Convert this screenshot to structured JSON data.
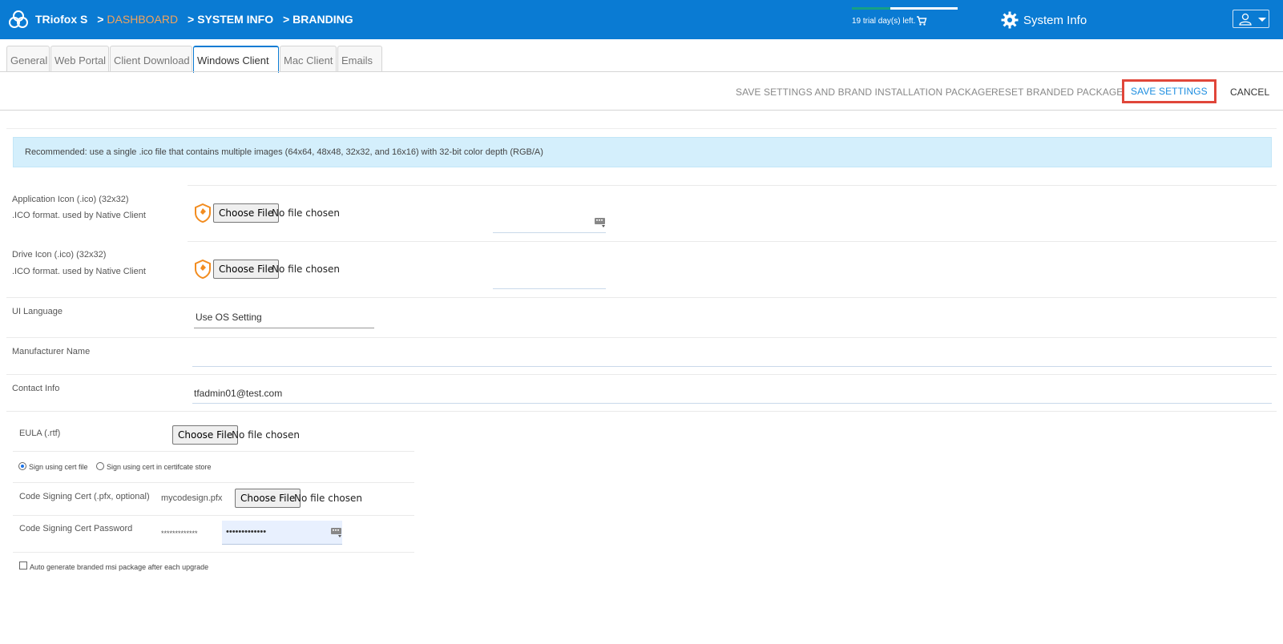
{
  "header": {
    "app_name": "TRiofox S",
    "crumbs": [
      "DASHBOARD",
      "SYSTEM INFO",
      "BRANDING"
    ],
    "crumb_sep": ">",
    "trial_text": "19 trial day(s) left.",
    "trial_progress": 0.36,
    "system_info_label": "System Info"
  },
  "tabs": [
    {
      "label": "General"
    },
    {
      "label": "Web Portal"
    },
    {
      "label": "Client Download"
    },
    {
      "label": "Windows Client"
    },
    {
      "label": "Mac Client"
    },
    {
      "label": "Emails"
    }
  ],
  "active_tab": "Windows Client",
  "toolbar": {
    "save_and_brand": "SAVE SETTINGS AND BRAND INSTALLATION PACKAGE",
    "reset": "RESET BRANDED PACKAGE",
    "save": "SAVE SETTINGS",
    "cancel": "CANCEL"
  },
  "notice": "Recommended: use a single .ico file that contains multiple images (64x64, 48x48, 32x32, and 16x16) with 32-bit color depth (RGB/A)",
  "form": {
    "choose_file": "Choose File",
    "no_file": "No file chosen",
    "app_icon": {
      "label": "Application Icon (.ico) (32x32)",
      "sub": ".ICO format. used by Native Client"
    },
    "drive_icon": {
      "label": "Drive Icon (.ico) (32x32)",
      "sub": ".ICO format. used by Native Client"
    },
    "ui_language": {
      "label": "UI Language",
      "value": "Use OS Setting"
    },
    "manufacturer": {
      "label": "Manufacturer Name",
      "value": ""
    },
    "contact": {
      "label": "Contact Info",
      "value": "tfadmin01@test.com"
    },
    "eula": {
      "label": "EULA (.rtf)"
    },
    "sign_cert_file": "Sign using cert file",
    "sign_cert_store": "Sign using cert in certifcate store",
    "code_cert": {
      "label": "Code Signing Cert (.pfx, optional)",
      "current": "mycodesign.pfx"
    },
    "code_pw": {
      "label": "Code Signing Cert Password",
      "mask": "*************",
      "value": "•••••••••••••"
    },
    "auto_generate": "Auto generate branded msi package after each upgrade"
  },
  "colors": {
    "header": "#0a7bd3",
    "crumb_link": "#f1a35c",
    "save_highlight": "#e0463a",
    "notice_bg": "#d4effc"
  }
}
